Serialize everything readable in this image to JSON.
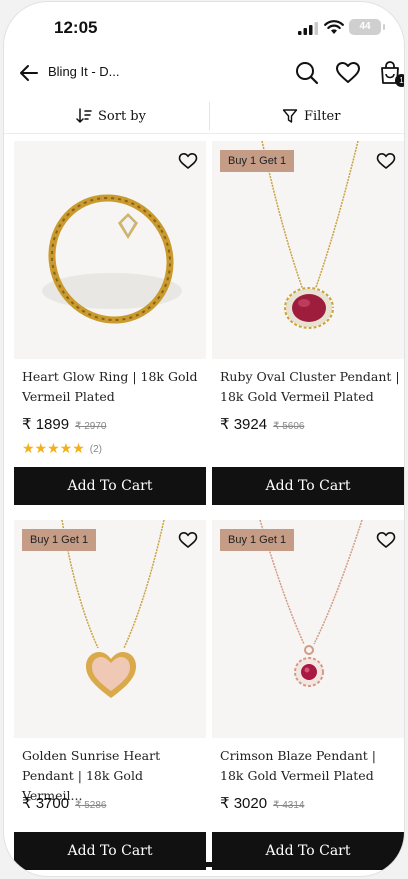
{
  "status_bar": {
    "time": "12:05",
    "battery": "44"
  },
  "header": {
    "title": "Bling It - D...",
    "cart_count": "1"
  },
  "toolbar": {
    "sort_label": "Sort by",
    "filter_label": "Filter"
  },
  "products": [
    {
      "name": "Heart Glow Ring | 18k Gold Vermeil Plated",
      "price": "₹ 1899",
      "mrp": "₹ 2970",
      "offer": "",
      "rating_stars": 5,
      "rating_count": "(2)",
      "cta": "Add To Cart",
      "image_icon": "gold-ring-image"
    },
    {
      "name": "Ruby Oval Cluster Pendant | 18k Gold Vermeil Plated",
      "price": "₹ 3924",
      "mrp": "₹ 5606",
      "offer": "Buy 1 Get 1",
      "cta": "Add To Cart",
      "image_icon": "ruby-pendant-image"
    },
    {
      "name": "Golden Sunrise Heart Pendant | 18k Gold Vermeil...",
      "price": "₹ 3700",
      "mrp": "₹ 5286",
      "offer": "Buy 1 Get 1",
      "cta": "Add To Cart",
      "image_icon": "heart-pendant-image"
    },
    {
      "name": "Crimson Blaze Pendant | 18k Gold Vermeil Plated",
      "price": "₹ 3020",
      "mrp": "₹ 4314",
      "offer": "Buy 1 Get 1",
      "cta": "Add To Cart",
      "image_icon": "crimson-pendant-image"
    }
  ],
  "colors": {
    "offer_bg": "#c59c86",
    "button_bg": "#111111",
    "star": "#f2b01e"
  }
}
